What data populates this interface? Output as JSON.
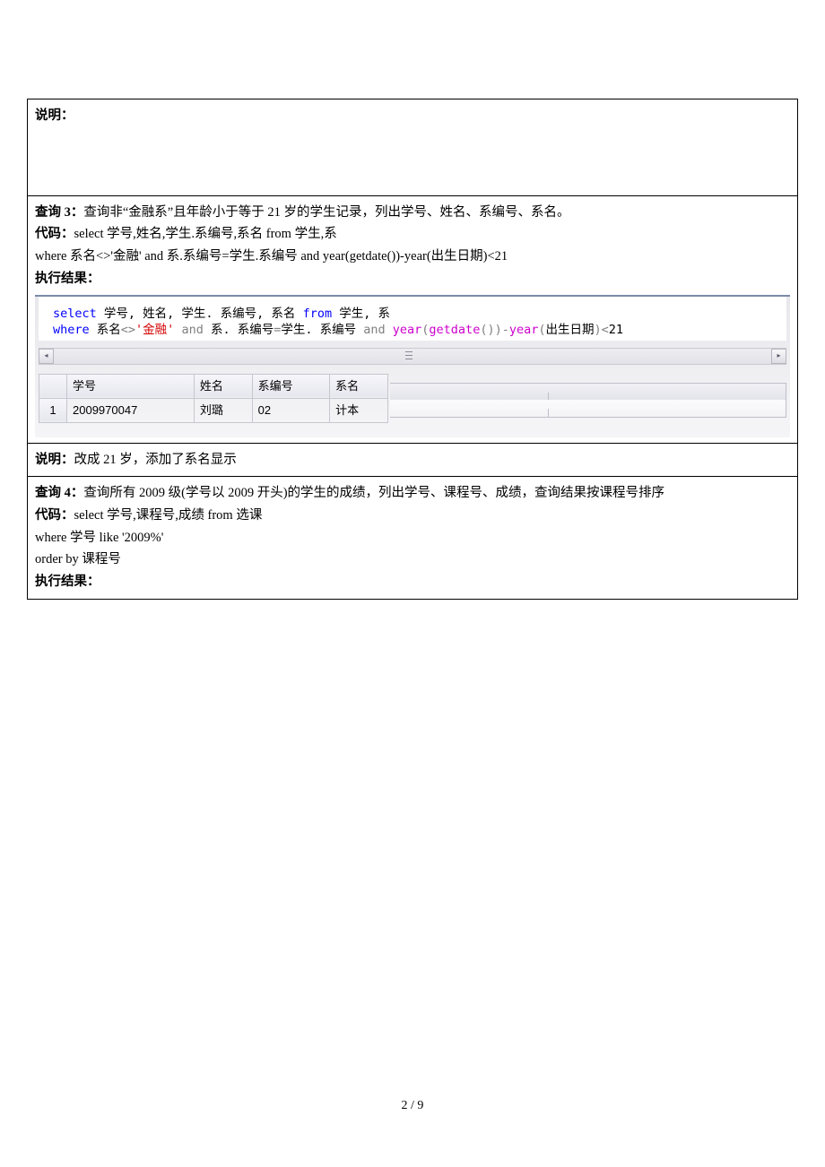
{
  "labels": {
    "shuoming": "说明：",
    "daima": "代码：",
    "zhixing": "执行结果：",
    "chaxun3": "查询 3：",
    "chaxun4": "查询 4："
  },
  "q3": {
    "desc": "查询非“金融系”且年龄小于等于 21 岁的学生记录，列出学号、姓名、系编号、系名。",
    "code_line1": "select 学号,姓名,学生.系编号,系名 from 学生,系",
    "code_line2": "where 系名<>'金融' and  系.系编号=学生.系编号  and year(getdate())-year(出生日期)<21",
    "shuoming_text": "改成 21 岁，添加了系名显示"
  },
  "sql": {
    "l1": {
      "select": "select",
      "cols": " 学号, 姓名, 学生. 系编号, 系名 ",
      "from": "from",
      "tables": " 学生, 系"
    },
    "l2": {
      "where": "where",
      "c1a": " 系名",
      "ne": "<>",
      "lit": "'金融'",
      "and1": " and ",
      "c2": "系. 系编号",
      "eq": "=",
      "c3": "学生. 系编号",
      "and2": "  and ",
      "year1": "year",
      "p1": "(",
      "getdate": "getdate",
      "p2": "())",
      "minus": "-",
      "year2": "year",
      "p3": "(",
      "arg": "出生日期",
      "p4": ")",
      "lt": "<",
      "num": "21"
    }
  },
  "grid": {
    "headers": [
      "学号",
      "姓名",
      "系编号",
      "系名"
    ],
    "rownum": "1",
    "row": [
      "2009970047",
      "刘璐",
      "02",
      "计本"
    ]
  },
  "q4": {
    "desc": "查询所有 2009 级(学号以 2009  开头)的学生的成绩，列出学号、课程号、成绩，查询结果按课程号排序",
    "code_line1": "select 学号,课程号,成绩 from 选课",
    "code_line2": "where 学号 like '2009%'",
    "code_line3": "order by 课程号"
  },
  "page_no": "2 / 9"
}
